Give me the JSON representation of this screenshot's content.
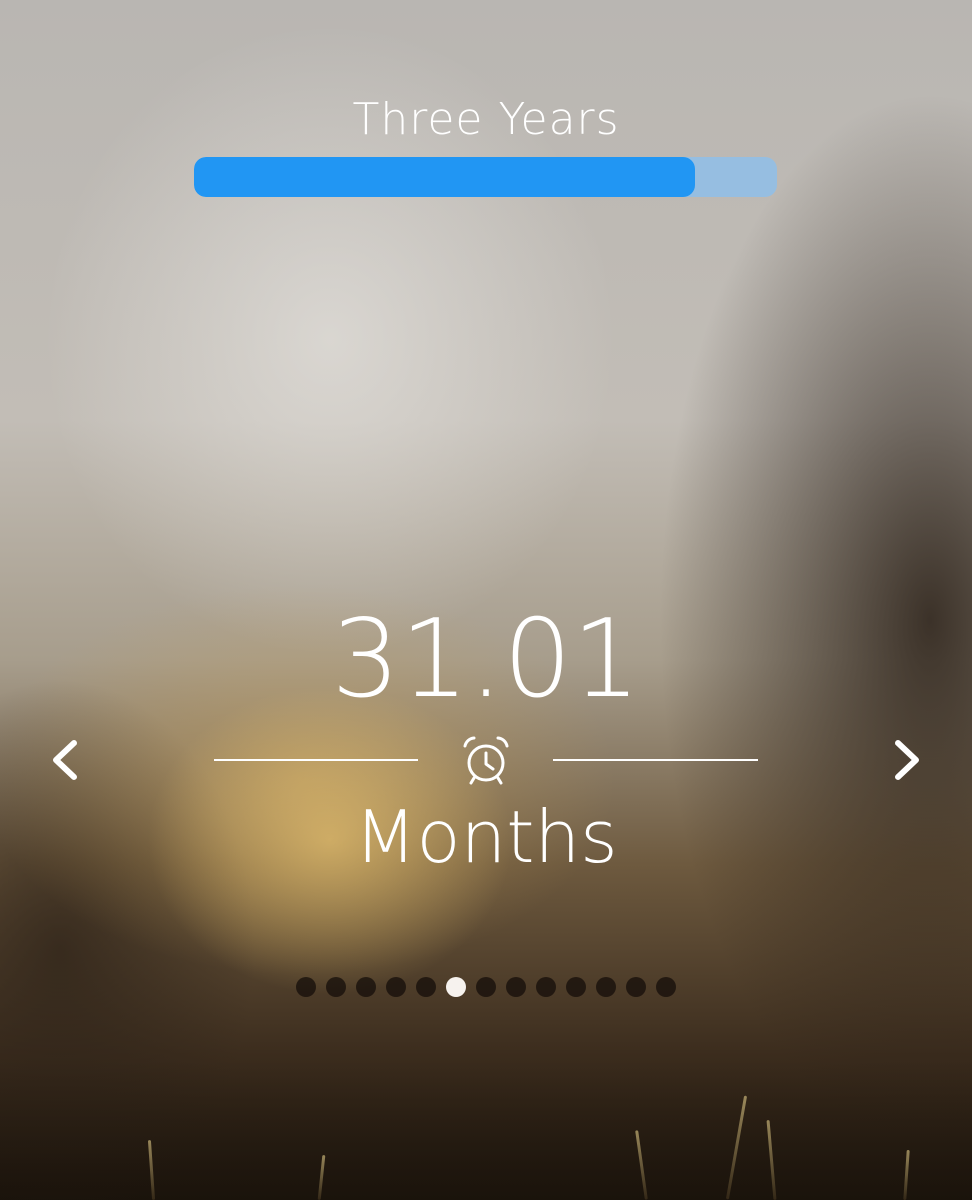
{
  "goal": {
    "title": "Three Years",
    "progress_fraction": 0.86,
    "colors": {
      "fill": "#2196f3",
      "track": "#96bee1"
    }
  },
  "counter": {
    "value": "31.01",
    "unit": "Months",
    "divider_icon": "alarm-clock-icon"
  },
  "navigation": {
    "prev_icon": "chevron-left-icon",
    "next_icon": "chevron-right-icon"
  },
  "pager": {
    "total_pages": 13,
    "current_index": 5
  }
}
